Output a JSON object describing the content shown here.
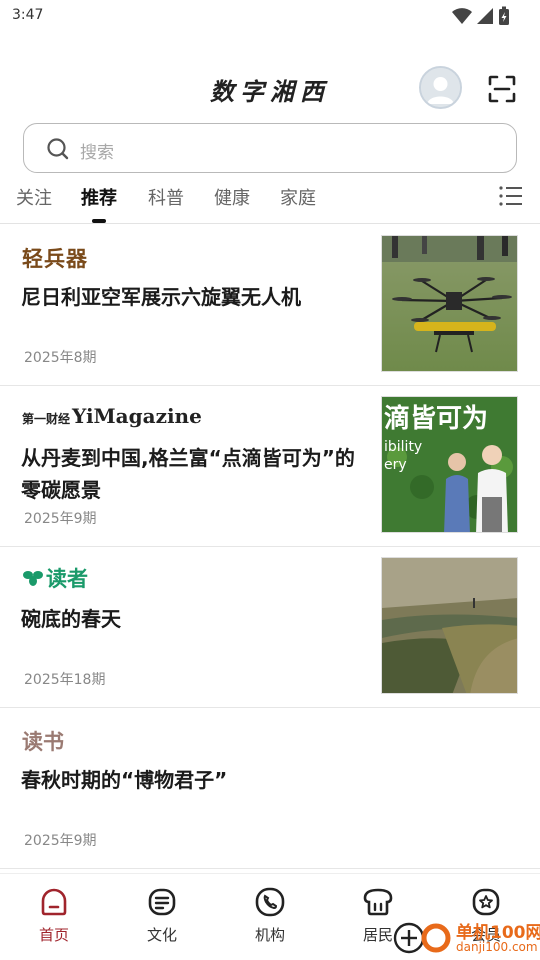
{
  "status_bar": {
    "time": "3:47"
  },
  "header": {
    "app_title": "数字湘西"
  },
  "search": {
    "placeholder": "搜索"
  },
  "tabs": [
    {
      "label": "关注"
    },
    {
      "label": "推荐",
      "active": true
    },
    {
      "label": "科普"
    },
    {
      "label": "健康"
    },
    {
      "label": "家庭"
    }
  ],
  "articles": [
    {
      "magazine": "轻兵器",
      "title": "尼日利亚空军展示六旋翼无人机",
      "issue": "2025年8期",
      "thumbnail": "drone-on-grass"
    },
    {
      "magazine_cn": "第一财经",
      "magazine_en": "YiMagazine",
      "title": "从丹麦到中国,格兰富“点滴皆可为”的零碳愿景",
      "issue": "2025年9期",
      "thumbnail": "two-people-green-wall",
      "thumbnail_text": "滴皆可为",
      "thumbnail_text2": "ibility",
      "thumbnail_text3": "ery"
    },
    {
      "magazine": "读者",
      "title": "碗底的春天",
      "issue": "2025年18期",
      "thumbnail": "landscape-painting"
    },
    {
      "magazine": "读书",
      "title": "春秋时期的“博物君子”",
      "issue": "2025年9期"
    }
  ],
  "bottom_nav": [
    {
      "label": "首页",
      "icon": "home-icon",
      "active": true
    },
    {
      "label": "文化",
      "icon": "culture-icon"
    },
    {
      "label": "机构",
      "icon": "phone-icon"
    },
    {
      "label": "居民",
      "icon": "resident-icon"
    },
    {
      "label": "会员",
      "icon": "member-icon"
    }
  ],
  "watermark": {
    "text": "单机100网",
    "url": "danji100.com"
  },
  "colors": {
    "accent": "#a0242c",
    "dz_green": "#1a9a6a"
  }
}
